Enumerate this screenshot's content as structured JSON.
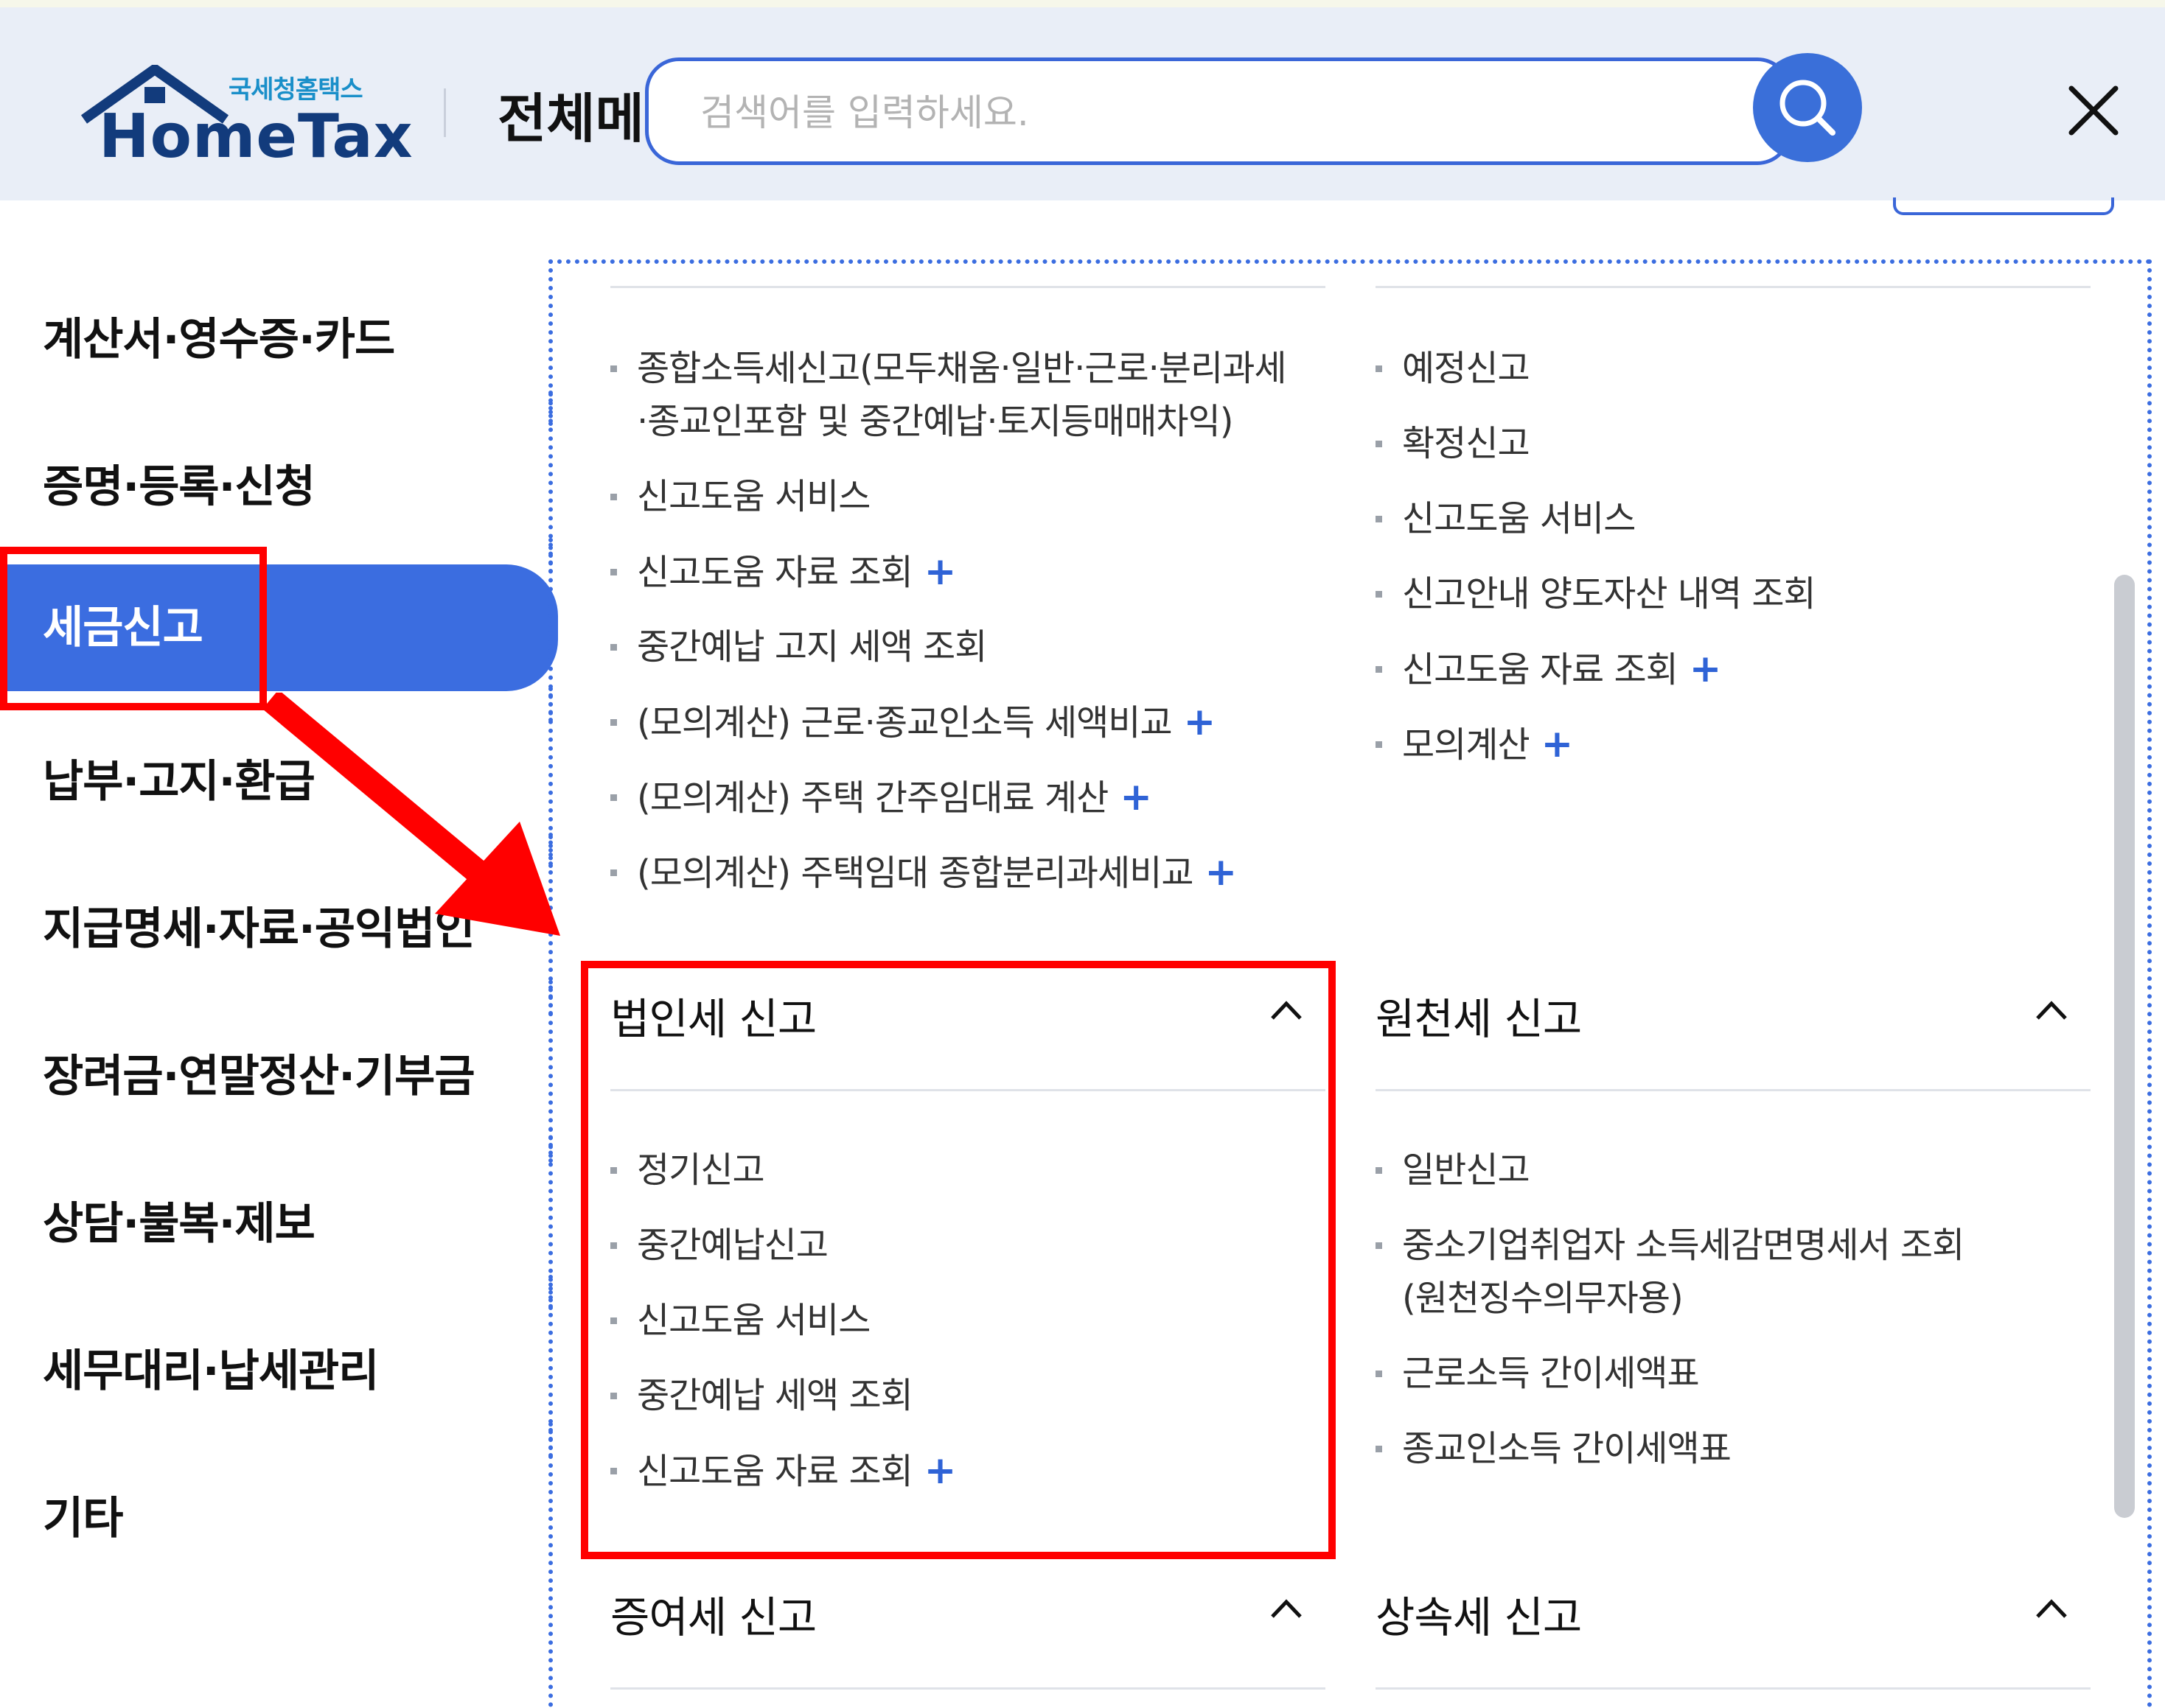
{
  "header": {
    "logo_small": "국세청홈택스",
    "logo_main": "HomeTax",
    "menu_title": "전체메뉴",
    "search_placeholder": "검색어를 입력하세요."
  },
  "icons": {
    "search": "search-icon",
    "close": "close-icon",
    "expand": "chevron-up-icon",
    "plus": "plus-icon"
  },
  "colors": {
    "accent": "#3b6de0",
    "plus": "#2f63d6",
    "annotation": "#ff0000"
  },
  "leftnav": {
    "items": [
      {
        "label": "계산서·영수증·카드",
        "active": false
      },
      {
        "label": "증명·등록·신청",
        "active": false
      },
      {
        "label": "세금신고",
        "active": true
      },
      {
        "label": "납부·고지·환급",
        "active": false
      },
      {
        "label": "지급명세·자료·공익법인",
        "active": false
      },
      {
        "label": "장려금·연말정산·기부금",
        "active": false
      },
      {
        "label": "상담·불복·제보",
        "active": false
      },
      {
        "label": "세무대리·납세관리",
        "active": false
      },
      {
        "label": "기타",
        "active": false
      }
    ]
  },
  "sections": {
    "income": {
      "items": [
        {
          "label": "종합소득세신고(모두채움·일반·근로·분리과세",
          "label2": "·종교인포함 및 중간예납·토지등매매차익)",
          "plus": ""
        },
        {
          "label": "신고도움 서비스",
          "plus": ""
        },
        {
          "label": "신고도움 자료 조회",
          "plus": "+"
        },
        {
          "label": "중간예납 고지 세액 조회",
          "plus": ""
        },
        {
          "label": "(모의계산) 근로·종교인소득 세액비교",
          "plus": "+"
        },
        {
          "label": "(모의계산) 주택 간주임대료 계산",
          "plus": "+"
        },
        {
          "label": "(모의계산) 주택임대 종합분리과세비교",
          "plus": "+"
        }
      ]
    },
    "transfer": {
      "items": [
        {
          "label": "예정신고",
          "plus": ""
        },
        {
          "label": "확정신고",
          "plus": ""
        },
        {
          "label": "신고도움 서비스",
          "plus": ""
        },
        {
          "label": "신고안내 양도자산 내역 조회",
          "plus": ""
        },
        {
          "label": "신고도움 자료 조회",
          "plus": "+"
        },
        {
          "label": "모의계산",
          "plus": "+"
        }
      ]
    },
    "corporate": {
      "title": "법인세 신고",
      "items": [
        {
          "label": "정기신고",
          "plus": ""
        },
        {
          "label": "중간예납신고",
          "plus": ""
        },
        {
          "label": "신고도움 서비스",
          "plus": ""
        },
        {
          "label": "중간예납 세액 조회",
          "plus": ""
        },
        {
          "label": "신고도움 자료 조회",
          "plus": "+"
        }
      ]
    },
    "withholding": {
      "title": "원천세 신고",
      "items": [
        {
          "label": "일반신고",
          "plus": ""
        },
        {
          "label": "중소기업취업자 소득세감면명세서 조회",
          "label2": "(원천징수의무자용)",
          "plus": ""
        },
        {
          "label": "근로소득 간이세액표",
          "plus": ""
        },
        {
          "label": "종교인소득 간이세액표",
          "plus": ""
        }
      ]
    },
    "gift": {
      "title": "증여세 신고"
    },
    "inheritance": {
      "title": "상속세 신고"
    }
  }
}
